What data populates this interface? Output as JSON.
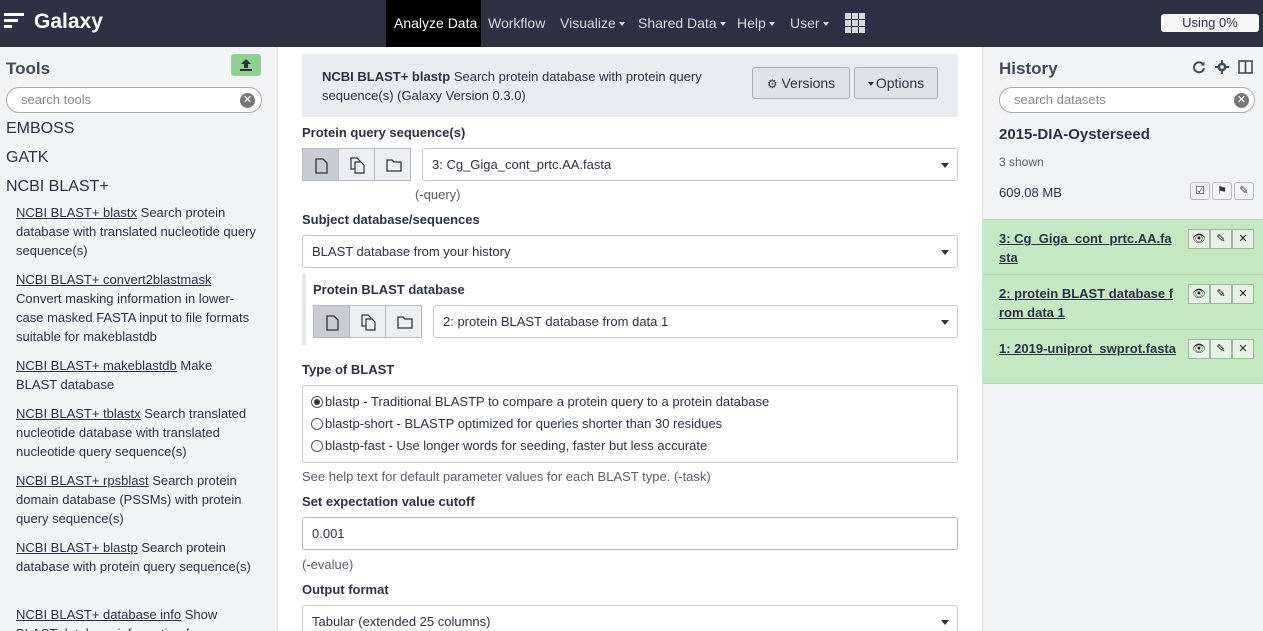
{
  "masthead": {
    "brand": "Galaxy",
    "nav": [
      {
        "label": "Analyze Data",
        "active": true,
        "dropdown": false
      },
      {
        "label": "Workflow",
        "active": false,
        "dropdown": false
      },
      {
        "label": "Visualize",
        "active": false,
        "dropdown": true
      },
      {
        "label": "Shared Data",
        "active": false,
        "dropdown": true
      },
      {
        "label": "Help",
        "active": false,
        "dropdown": true
      },
      {
        "label": "User",
        "active": false,
        "dropdown": true
      }
    ],
    "quota": "Using 0%"
  },
  "tools_panel": {
    "title": "Tools",
    "search_placeholder": "search tools",
    "sections": [
      "EMBOSS",
      "GATK",
      "NCBI BLAST+"
    ],
    "tools": [
      {
        "name": "NCBI BLAST+ blastx",
        "desc": " Search protein database with translated nucleotide query sequence(s)"
      },
      {
        "name": "NCBI BLAST+ convert2blastmask",
        "desc": " Convert masking information in lower-case masked FASTA input to file formats suitable for makeblastdb"
      },
      {
        "name": "NCBI BLAST+ makeblastdb",
        "desc": " Make BLAST database"
      },
      {
        "name": "NCBI BLAST+ tblastx",
        "desc": " Search translated nucleotide database with translated nucleotide query sequence(s)"
      },
      {
        "name": "NCBI BLAST+ rpsblast",
        "desc": " Search protein domain database (PSSMs) with protein query sequence(s)"
      },
      {
        "name": "NCBI BLAST+ blastp",
        "desc": " Search protein database with protein query sequence(s)"
      },
      {
        "name": "NCBI BLAST+ database info",
        "desc": " Show BLAST database information from"
      }
    ]
  },
  "tool_form": {
    "name": "NCBI BLAST+ blastp",
    "description": " Search protein database with protein query sequence(s) (Galaxy Version 0.3.0)",
    "versions_label": "Versions",
    "options_label": "Options",
    "query_label": "Protein query sequence(s)",
    "query_value": "3: Cg_Giga_cont_prtc.AA.fasta",
    "query_hint": "(-query)",
    "subject_label": "Subject database/sequences",
    "subject_value": "BLAST database from your history",
    "db_label": "Protein BLAST database",
    "db_value": "2: protein BLAST database from data 1",
    "type_label": "Type of BLAST",
    "type_options": [
      {
        "label": "blastp - Traditional BLASTP to compare a protein query to a protein database",
        "checked": true
      },
      {
        "label": "blastp-short - BLASTP optimized for queries shorter than 30 residues",
        "checked": false
      },
      {
        "label": "blastp-fast - Use longer words for seeding, faster but less accurate",
        "checked": false
      }
    ],
    "type_hint": "See help text for default parameter values for each BLAST type. (-task)",
    "evalue_label": "Set expectation value cutoff",
    "evalue_value": "0.001",
    "evalue_hint": "(-evalue)",
    "output_label": "Output format",
    "output_value": "Tabular (extended 25 columns)"
  },
  "history": {
    "title": "History",
    "search_placeholder": "search datasets",
    "name": "2015-DIA-Oysterseed",
    "shown": "3 shown",
    "size": "609.08 MB",
    "datasets": [
      {
        "title": "3: Cg_Giga_cont_prtc.AA.fasta"
      },
      {
        "title": "2: protein BLAST database from data 1"
      },
      {
        "title": "1: 2019-uniprot_swprot.fasta"
      }
    ]
  }
}
